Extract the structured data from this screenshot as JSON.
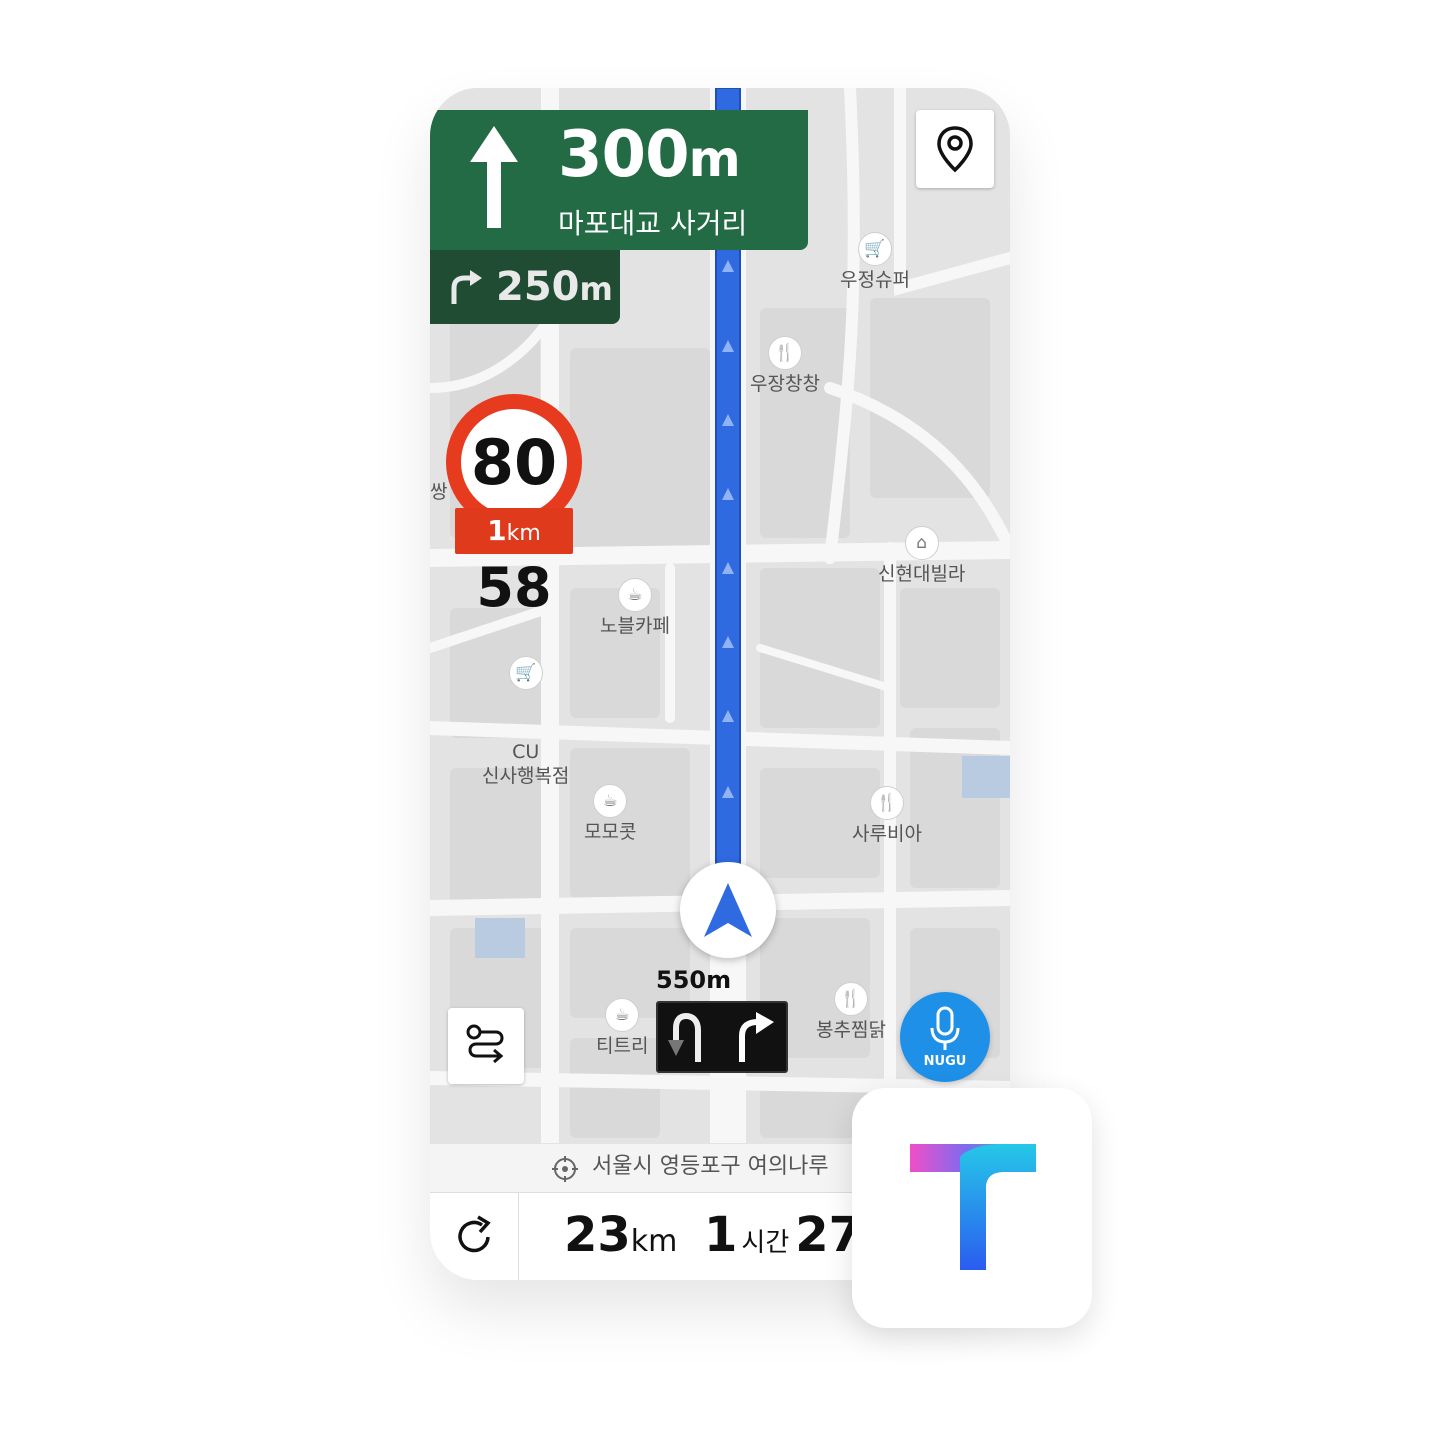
{
  "guidance": {
    "main_distance": "300",
    "main_unit": "m",
    "main_place": "마포대교 사거리",
    "main_direction": "straight-arrow-icon",
    "next_distance": "250",
    "next_unit": "m",
    "next_direction": "turn-right-icon"
  },
  "speed": {
    "limit": "80",
    "camera_distance": "1",
    "camera_unit": "km",
    "current": "58"
  },
  "pois": [
    {
      "label": "우정슈퍼",
      "icon": "cart-icon"
    },
    {
      "label": "우장창창",
      "icon": "restaurant-icon"
    },
    {
      "label": "신현대빌라",
      "icon": "building-icon"
    },
    {
      "label": "노블카페",
      "icon": "cafe-icon"
    },
    {
      "label": "CU\n신사행복점",
      "icon": "cart-icon"
    },
    {
      "label": "모모콧",
      "icon": "cafe-icon"
    },
    {
      "label": "사루비아",
      "icon": "restaurant-icon"
    },
    {
      "label": "봉추찜닭",
      "icon": "restaurant-icon"
    },
    {
      "label": "티트리",
      "icon": "cafe-icon"
    },
    {
      "label": "쌍",
      "icon": ""
    }
  ],
  "lanes": {
    "distance": "550m",
    "items": [
      "u-turn-lane-icon",
      "right-turn-lane-icon"
    ]
  },
  "nugu": {
    "label": "NUGU"
  },
  "address": "서울시 영등포구 여의나루",
  "summary": {
    "distance_value": "23",
    "distance_unit": "km",
    "time_hours": "1",
    "time_hours_unit": "시간",
    "time_minutes": "27"
  },
  "colors": {
    "route": "#2f6ae0",
    "guide_green": "#236b45",
    "speed_red": "#e63b1f",
    "nugu_blue": "#1e90e8"
  }
}
